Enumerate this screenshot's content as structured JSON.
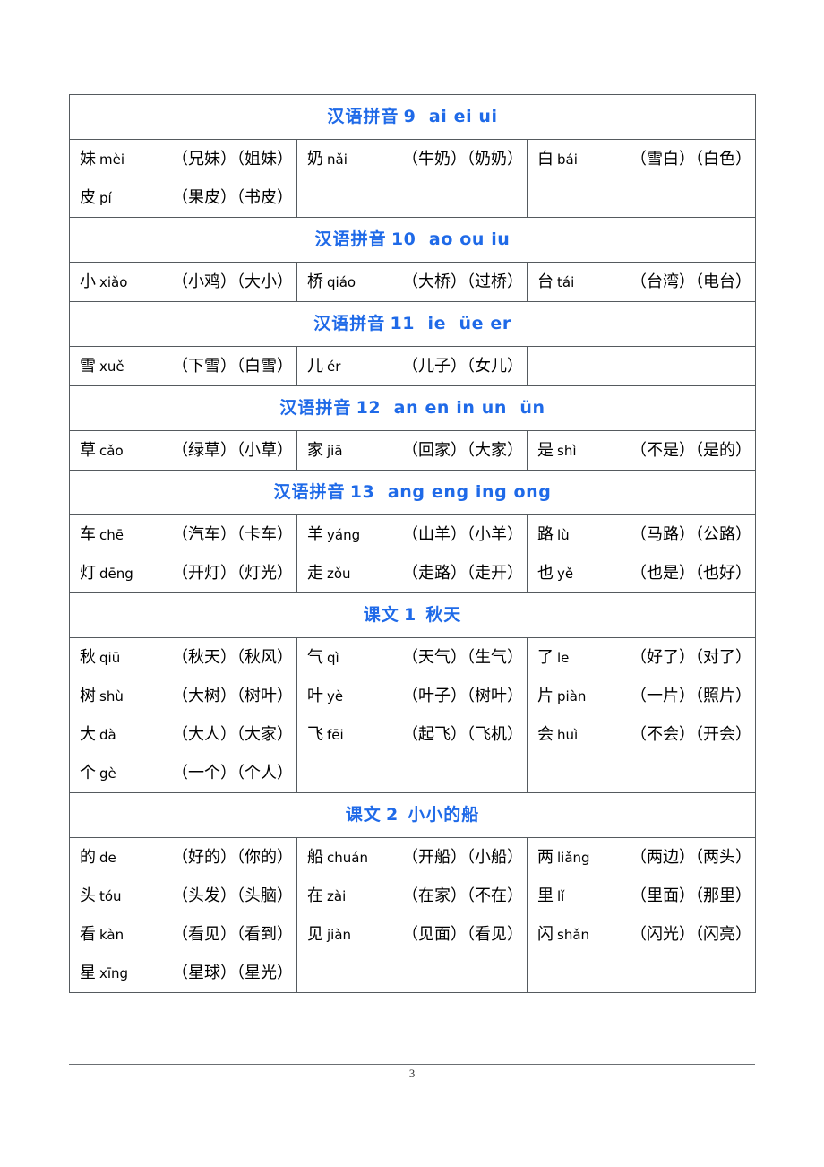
{
  "document": {
    "page_number": "3",
    "header_color": "#1f6ae8",
    "border_color": "#555a5e"
  },
  "sections": [
    {
      "title_han": "汉语拼音",
      "title_lat": "9  ai ei ui",
      "title_full": "汉语拼音 9 ai ei ui",
      "columns": [
        [
          {
            "char": "妹",
            "pinyin": "mèi",
            "words": "（兄妹）（姐妹）"
          },
          {
            "char": "皮",
            "pinyin": "pí",
            "words": "（果皮）（书皮）"
          }
        ],
        [
          {
            "char": "奶",
            "pinyin": "nǎi",
            "words": "（牛奶）（奶奶）"
          }
        ],
        [
          {
            "char": "白",
            "pinyin": "bái",
            "words": "（雪白）（白色）"
          }
        ]
      ]
    },
    {
      "title_han": "汉语拼音",
      "title_lat": "10  ao ou iu",
      "title_full": "汉语拼音 10 ao ou iu",
      "columns": [
        [
          {
            "char": "小",
            "pinyin": "xiǎo",
            "words": "（小鸡）（大小）"
          }
        ],
        [
          {
            "char": "桥",
            "pinyin": "qiáo",
            "words": "（大桥）（过桥）"
          }
        ],
        [
          {
            "char": "台",
            "pinyin": "tái",
            "words": "（台湾）（电台）"
          }
        ]
      ]
    },
    {
      "title_han": "汉语拼音",
      "title_lat": "11  ie  üe er",
      "title_full": "汉语拼音 11 ie üe er",
      "columns": [
        [
          {
            "char": "雪",
            "pinyin": "xuě",
            "words": "（下雪）（白雪）"
          }
        ],
        [
          {
            "char": "儿",
            "pinyin": "ér",
            "words": "（儿子）（女儿）"
          }
        ],
        [
          {
            "char": "",
            "pinyin": "",
            "words": ""
          }
        ]
      ]
    },
    {
      "title_han": "汉语拼音",
      "title_lat": "12  an en in un  ün",
      "title_full": "汉语拼音 12 an en in un ün",
      "columns": [
        [
          {
            "char": "草",
            "pinyin": "cǎo",
            "words": "（绿草）（小草）"
          }
        ],
        [
          {
            "char": "家",
            "pinyin": "jiā",
            "words": "（回家）（大家）"
          }
        ],
        [
          {
            "char": "是",
            "pinyin": "shì",
            "words": "（不是）（是的）"
          }
        ]
      ]
    },
    {
      "title_han": "汉语拼音",
      "title_lat": "13  ang eng ing ong",
      "title_full": "汉语拼音 13 ang eng ing ong",
      "columns": [
        [
          {
            "char": "车",
            "pinyin": "chē",
            "words": "（汽车）（卡车）"
          },
          {
            "char": "灯",
            "pinyin": "dēng",
            "words": "（开灯）（灯光）"
          }
        ],
        [
          {
            "char": "羊",
            "pinyin": "yáng",
            "words": "（山羊）（小羊）"
          },
          {
            "char": "走",
            "pinyin": "zǒu",
            "words": "（走路）（走开）"
          }
        ],
        [
          {
            "char": "路",
            "pinyin": "lù",
            "words": "（马路）（公路）"
          },
          {
            "char": "也",
            "pinyin": "yě",
            "words": "（也是）（也好）"
          }
        ]
      ]
    },
    {
      "title_han": "课文",
      "title_lat": "1",
      "title_tail": "秋天",
      "title_full": "课文 1 秋天",
      "columns": [
        [
          {
            "char": "秋",
            "pinyin": "qiū",
            "words": "（秋天）（秋风）"
          },
          {
            "char": "树",
            "pinyin": "shù",
            "words": "（大树）（树叶）"
          },
          {
            "char": "大",
            "pinyin": "dà",
            "words": "（大人）（大家）"
          },
          {
            "char": "个",
            "pinyin": "gè",
            "words": "（一个）（个人）"
          }
        ],
        [
          {
            "char": "气",
            "pinyin": "qì",
            "words": "（天气）（生气）"
          },
          {
            "char": "叶",
            "pinyin": "yè",
            "words": "（叶子）（树叶）"
          },
          {
            "char": "飞",
            "pinyin": "fēi",
            "words": "（起飞）（飞机）"
          }
        ],
        [
          {
            "char": "了",
            "pinyin": "le",
            "words": "（好了）（对了）"
          },
          {
            "char": "片",
            "pinyin": "piàn",
            "words": "（一片）（照片）"
          },
          {
            "char": "会",
            "pinyin": "huì",
            "words": "（不会）（开会）"
          }
        ]
      ]
    },
    {
      "title_han": "课文",
      "title_lat": "2",
      "title_tail": "小小的船",
      "title_full": "课文 2 小小的船",
      "columns": [
        [
          {
            "char": "的",
            "pinyin": "de",
            "words": "（好的）（你的）"
          },
          {
            "char": "头",
            "pinyin": "tóu",
            "words": "（头发）（头脑）"
          },
          {
            "char": "看",
            "pinyin": "kàn",
            "words": "（看见）（看到）"
          },
          {
            "char": "星",
            "pinyin": "xīng",
            "words": "（星球）（星光）"
          }
        ],
        [
          {
            "char": "船",
            "pinyin": "chuán",
            "words": "（开船）（小船）"
          },
          {
            "char": "在",
            "pinyin": "zài",
            "words": "（在家）（不在）"
          },
          {
            "char": "见",
            "pinyin": "jiàn",
            "words": "（见面）（看见）"
          }
        ],
        [
          {
            "char": "两",
            "pinyin": "liǎng",
            "words": "（两边）（两头）"
          },
          {
            "char": "里",
            "pinyin": "lǐ",
            "words": "（里面）（那里）"
          },
          {
            "char": "闪",
            "pinyin": "shǎn",
            "words": "（闪光）（闪亮）"
          }
        ]
      ]
    }
  ]
}
